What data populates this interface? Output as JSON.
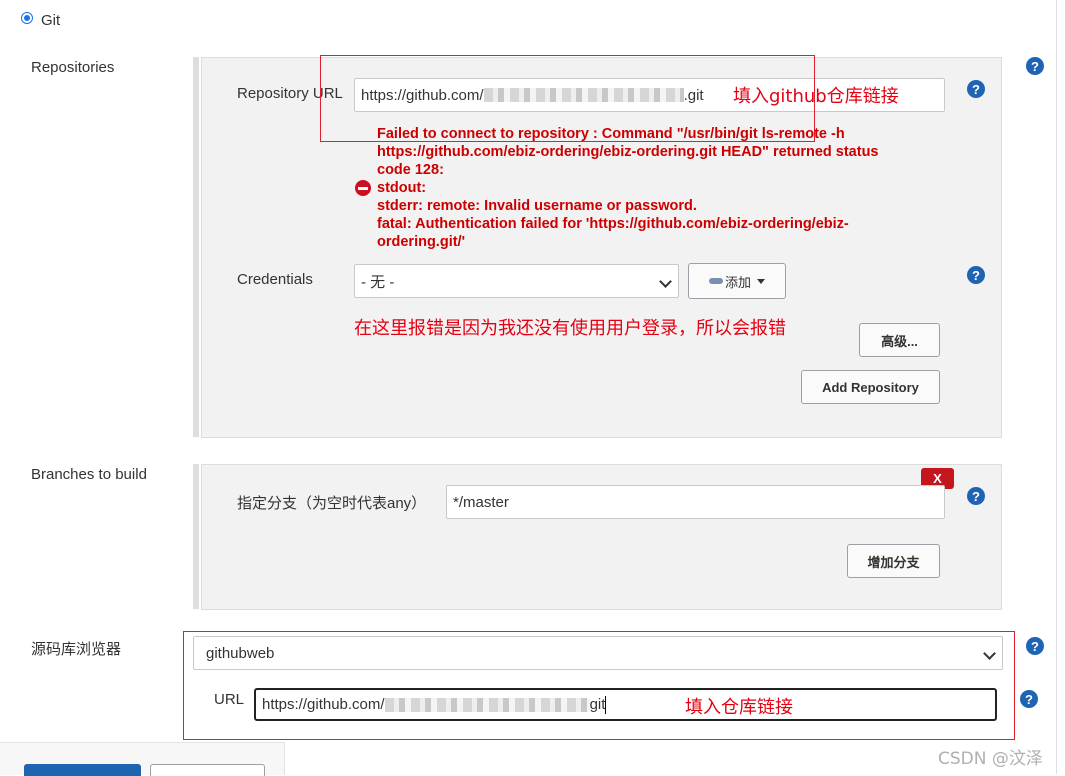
{
  "scm": {
    "git_label": "Git"
  },
  "repositories": {
    "section_label": "Repositories",
    "url_label": "Repository URL",
    "url_prefix": "https://github.com/",
    "url_suffix": ".git",
    "url_annotation": "填入github仓库链接",
    "error_lines": [
      "Failed to connect to repository : Command \"/usr/bin/git ls-remote -h",
      "https://github.com/ebiz-ordering/ebiz-ordering.git HEAD\" returned status",
      "code 128:",
      "stdout:",
      "stderr: remote: Invalid username or password.",
      "fatal: Authentication failed for 'https://github.com/ebiz-ordering/ebiz-",
      "ordering.git/'"
    ],
    "credentials_label": "Credentials",
    "credentials_value": "- 无 -",
    "add_button_label": "添加",
    "credentials_annotation": "在这里报错是因为我还没有使用用户登录，所以会报错",
    "advanced_button_label": "高级...",
    "add_repository_label": "Add Repository"
  },
  "branches": {
    "section_label": "Branches to build",
    "branch_label": "指定分支（为空时代表any）",
    "branch_value": "*/master",
    "remove_label": "X",
    "add_branch_label": "增加分支"
  },
  "browser": {
    "section_label": "源码库浏览器",
    "selected_value": "githubweb",
    "url_label": "URL",
    "url_prefix": "https://github.com/",
    "url_suffix": "git",
    "url_annotation": "填入仓库链接"
  },
  "help_glyph": "?",
  "watermark": "CSDN @汶泽",
  "colors": {
    "error": "#cc0000",
    "annotation": "#e60012",
    "help": "#1f64b3"
  }
}
